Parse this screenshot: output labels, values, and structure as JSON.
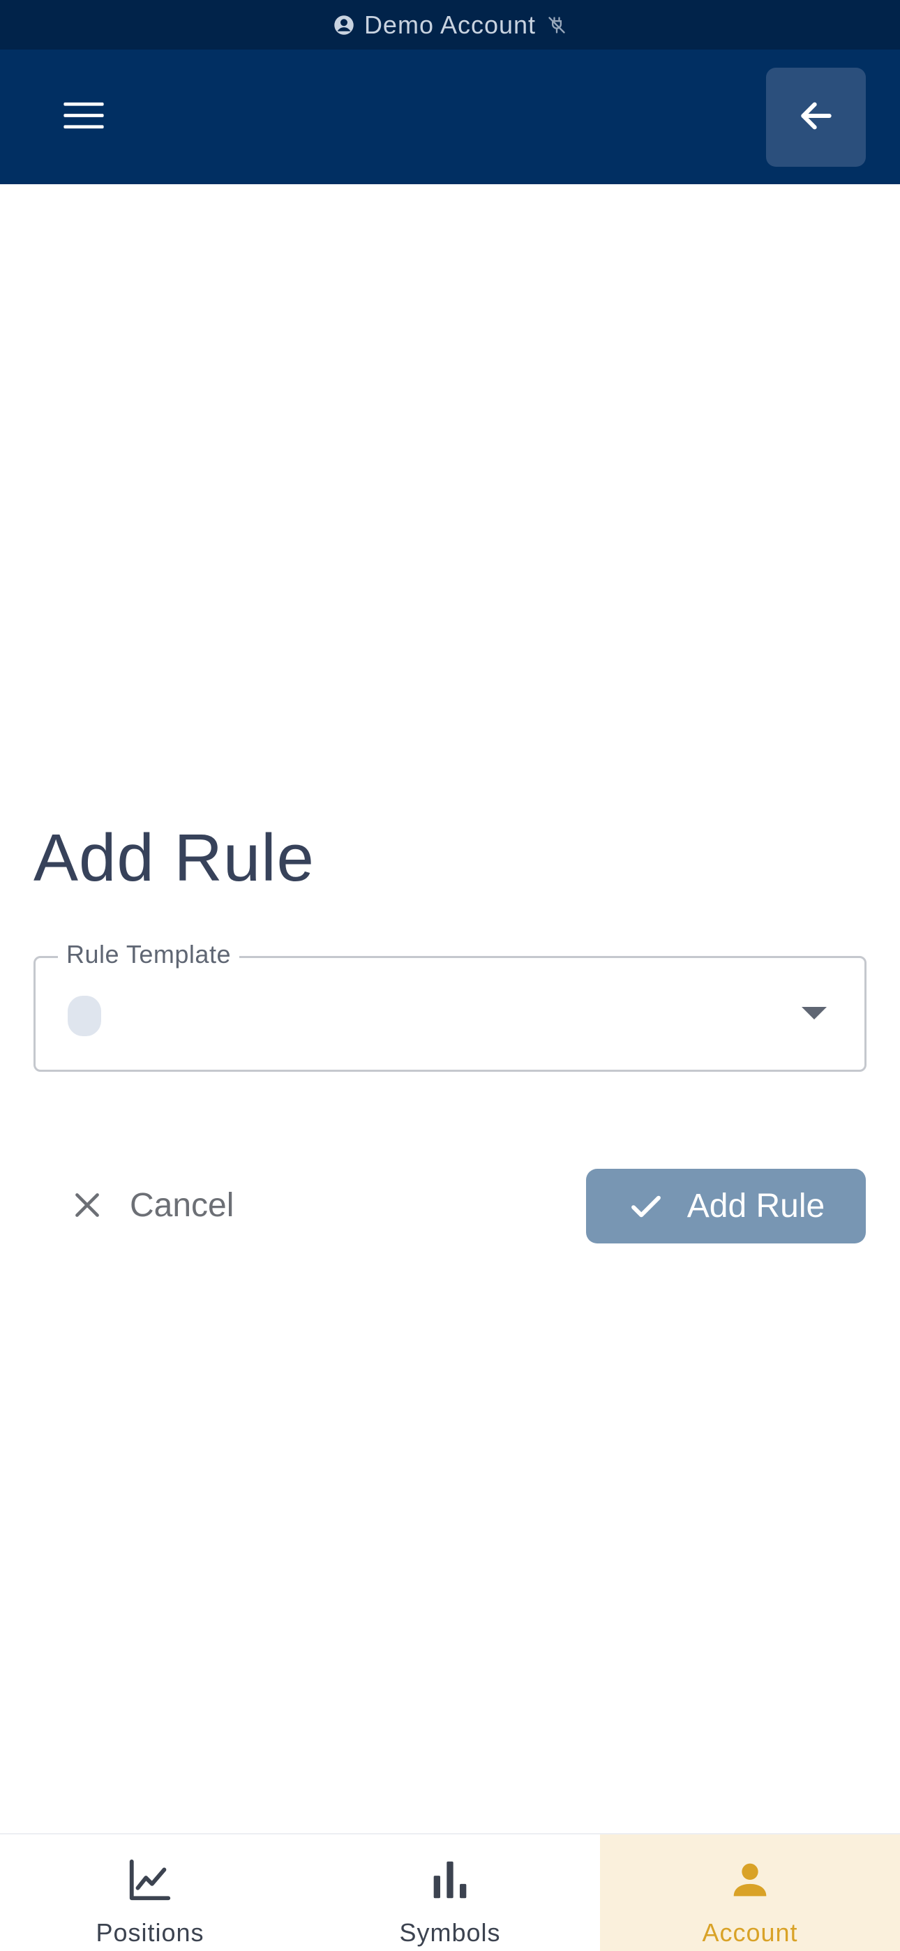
{
  "status_bar": {
    "account_label": "Demo Account",
    "account_icon": "account-circle-icon",
    "connection_icon": "plug-off-icon"
  },
  "header": {
    "menu_icon": "hamburger-menu-icon",
    "back_icon": "arrow-left-icon"
  },
  "main": {
    "title": "Add Rule",
    "rule_template": {
      "label": "Rule Template",
      "value": ""
    },
    "cancel_label": "Cancel",
    "submit_label": "Add Rule"
  },
  "bottom_nav": {
    "items": [
      {
        "label": "Positions",
        "icon": "line-chart-icon",
        "active": false
      },
      {
        "label": "Symbols",
        "icon": "bar-chart-icon",
        "active": false
      },
      {
        "label": "Account",
        "icon": "person-icon",
        "active": true
      }
    ]
  },
  "colors": {
    "status_bar_bg": "#01234a",
    "header_bg": "#012f62",
    "primary_button": "#7896b3",
    "accent": "#d9a227",
    "active_nav_bg": "#faf0dc",
    "title_text": "#37425a"
  }
}
